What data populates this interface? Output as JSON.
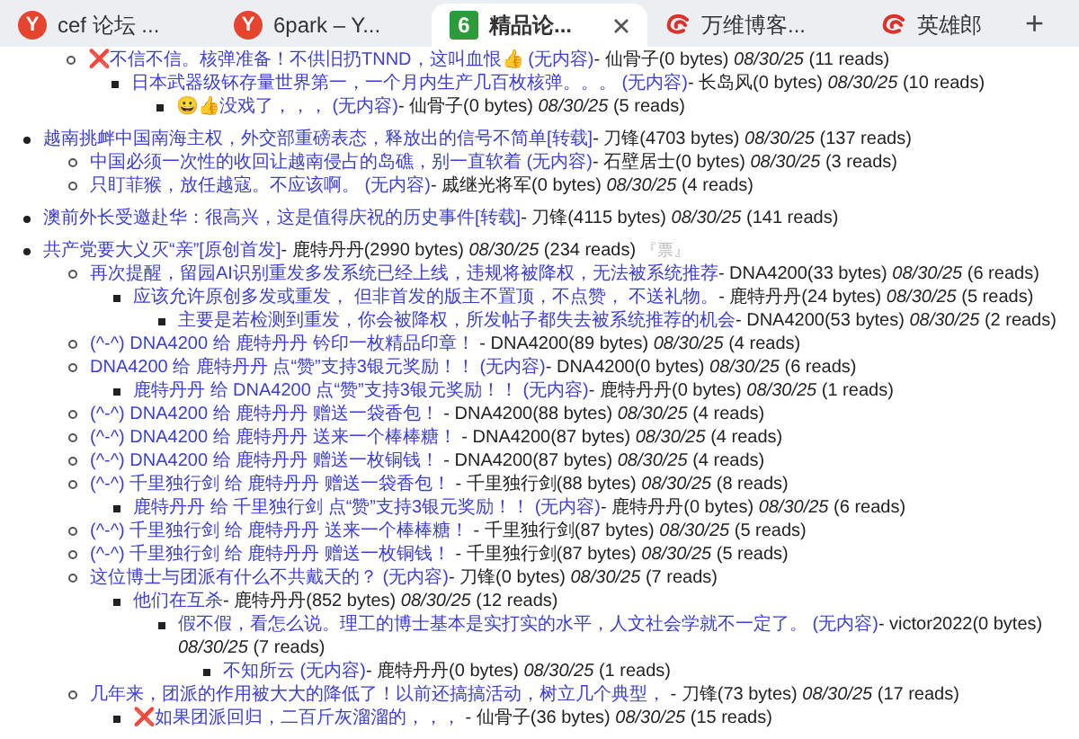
{
  "tabs": [
    {
      "favicon": {
        "kind": "letter",
        "glyph": "Y",
        "color": "#e5442f"
      },
      "title": "cef 论坛 ...",
      "selected": false,
      "closable": false
    },
    {
      "favicon": {
        "kind": "letter",
        "glyph": "Y",
        "color": "#e5442f"
      },
      "title": "6park – Y...",
      "selected": false,
      "closable": false
    },
    {
      "favicon": {
        "kind": "square",
        "glyph": "6",
        "color": "#2e9b3a"
      },
      "title": "精品论...",
      "selected": true,
      "closable": true
    },
    {
      "favicon": {
        "kind": "swirl",
        "color": "#d9322b"
      },
      "title": "万维博客...",
      "selected": false,
      "closable": false
    },
    {
      "favicon": {
        "kind": "swirl",
        "color": "#d9322b"
      },
      "title": "英雄郎",
      "selected": false,
      "closable": false
    }
  ],
  "new_tab": "+",
  "threads": [
    {
      "continued": true,
      "posts": [
        {
          "mark": "❌",
          "title": "不信不信。核弹准备！不供旧扔TNND，这叫血恨👍",
          "note": "(无内容)",
          "author": "- 仙骨子(0 bytes)",
          "date": "08/30/25",
          "reads": "(11 reads)",
          "children": [
            {
              "title": "日本武器级钚存量世界第一，一个月内生产几百枚核弹。。。",
              "note": "(无内容)",
              "author": "- 长岛风(0 bytes)",
              "date": "08/30/25",
              "reads": "(10 reads)",
              "children": [
                {
                  "title": "😀👍没戏了，，，",
                  "note": "(无内容)",
                  "author": "- 仙骨子(0 bytes)",
                  "date": "08/30/25",
                  "reads": "(5 reads)"
                }
              ]
            }
          ]
        }
      ]
    },
    {
      "continued": false,
      "posts": [
        {
          "title": "越南挑衅中国南海主权，外交部重磅表态，释放出的信号不简单[转载]",
          "author": "- 刀锋(4703 bytes)",
          "date": "08/30/25",
          "reads": "(137 reads)",
          "children": [
            {
              "title": "中国必须一次性的收回让越南侵占的岛礁，别一直软着",
              "note": "(无内容)",
              "author": "- 石壁居士(0 bytes)",
              "date": "08/30/25",
              "reads": "(3 reads)"
            },
            {
              "title": "只盯菲猴，放任越寇。不应该啊。",
              "note": "(无内容)",
              "author": "- 戚继光将军(0 bytes)",
              "date": "08/30/25",
              "reads": "(4 reads)"
            }
          ]
        }
      ]
    },
    {
      "continued": false,
      "posts": [
        {
          "title": "澳前外长受邀赴华：很高兴，这是值得庆祝的历史事件[转载]",
          "author": "- 刀锋(4115 bytes)",
          "date": "08/30/25",
          "reads": "(141 reads)"
        }
      ]
    },
    {
      "continued": false,
      "posts": [
        {
          "title": "共产党要大义灭“亲”[原创首发]",
          "author": "- 鹿特丹丹(2990 bytes)",
          "date": "08/30/25",
          "reads": "(234 reads)",
          "tag": "『票』",
          "children": [
            {
              "title": "再次提醒，留园AI识别重发多发系统已经上线，违规将被降权，无法被系统推荐",
              "author": "- DNA4200(33 bytes)",
              "date": "08/30/25",
              "reads": "(6 reads)",
              "children": [
                {
                  "title": "应该允许原创多发或重发， 但非首发的版主不置顶，不点赞， 不送礼物。",
                  "author": "- 鹿特丹丹(24 bytes)",
                  "date": "08/30/25",
                  "reads": "(5 reads)",
                  "children": [
                    {
                      "title": "主要是若检测到重发，你会被降权，所发帖子都失去被系统推荐的机会",
                      "author": "- DNA4200(53 bytes)",
                      "date": "08/30/25",
                      "reads": "(2 reads)"
                    }
                  ]
                }
              ]
            },
            {
              "title": "(^-^) DNA4200 给 鹿特丹丹 钤印一枚精品印章！",
              "author": " - DNA4200(89 bytes)",
              "date": "08/30/25",
              "reads": "(4 reads)"
            },
            {
              "title": "DNA4200 给 鹿特丹丹 点“赞”支持3银元奖励！！",
              "note": "(无内容)",
              "author": "- DNA4200(0 bytes)",
              "date": "08/30/25",
              "reads": "(6 reads)",
              "children": [
                {
                  "title": "鹿特丹丹 给 DNA4200 点“赞”支持3银元奖励！！",
                  "note": "(无内容)",
                  "author": "- 鹿特丹丹(0 bytes)",
                  "date": "08/30/25",
                  "reads": "(1 reads)"
                }
              ]
            },
            {
              "title": "(^-^) DNA4200 给 鹿特丹丹 赠送一袋香包！",
              "author": " - DNA4200(88 bytes)",
              "date": "08/30/25",
              "reads": "(4 reads)"
            },
            {
              "title": "(^-^) DNA4200 给 鹿特丹丹 送来一个棒棒糖！",
              "author": " - DNA4200(87 bytes)",
              "date": "08/30/25",
              "reads": "(4 reads)"
            },
            {
              "title": "(^-^) DNA4200 给 鹿特丹丹 赠送一枚铜钱！",
              "author": " - DNA4200(87 bytes)",
              "date": "08/30/25",
              "reads": "(4 reads)"
            },
            {
              "title": "(^-^) 千里独行剑 给 鹿特丹丹 赠送一袋香包！",
              "author": " - 千里独行剑(88 bytes)",
              "date": "08/30/25",
              "reads": "(8 reads)",
              "children": [
                {
                  "title": "鹿特丹丹 给 千里独行剑 点“赞”支持3银元奖励！！",
                  "note": "(无内容)",
                  "author": "- 鹿特丹丹(0 bytes)",
                  "date": "08/30/25",
                  "reads": "(6 reads)"
                }
              ]
            },
            {
              "title": "(^-^) 千里独行剑 给 鹿特丹丹 送来一个棒棒糖！",
              "author": " - 千里独行剑(87 bytes)",
              "date": "08/30/25",
              "reads": "(5 reads)"
            },
            {
              "title": "(^-^) 千里独行剑 给 鹿特丹丹 赠送一枚铜钱！",
              "author": " - 千里独行剑(87 bytes)",
              "date": "08/30/25",
              "reads": "(5 reads)"
            },
            {
              "title": "这位博士与团派有什么不共戴天的？",
              "note": "(无内容)",
              "author": "- 刀锋(0 bytes)",
              "date": "08/30/25",
              "reads": "(7 reads)",
              "children": [
                {
                  "title": "他们在互杀",
                  "author": "- 鹿特丹丹(852 bytes)",
                  "date": "08/30/25",
                  "reads": "(12 reads)",
                  "children": [
                    {
                      "title": "假不假，看怎么说。理工的博士基本是实打实的水平，人文社会学就不一定了。",
                      "note": "(无内容)",
                      "author": "- victor2022(0 bytes)",
                      "date": "08/30/25",
                      "reads": "(7 reads)",
                      "children": [
                        {
                          "title": "不知所云",
                          "note": "(无内容)",
                          "author": "- 鹿特丹丹(0 bytes)",
                          "date": "08/30/25",
                          "reads": "(1 reads)"
                        }
                      ]
                    }
                  ]
                }
              ]
            },
            {
              "title": "几年来，团派的作用被大大的降低了！以前还搞搞活动，树立几个典型，",
              "author": " - 刀锋(73 bytes)",
              "date": "08/30/25",
              "reads": "(17 reads)",
              "children": [
                {
                  "mark": "❌",
                  "title": "如果团派回归，二百斤灰溜溜的，，，",
                  "author": " - 仙骨子(36 bytes)",
                  "date": "08/30/25",
                  "reads": "(15 reads)"
                }
              ]
            }
          ]
        }
      ]
    }
  ]
}
